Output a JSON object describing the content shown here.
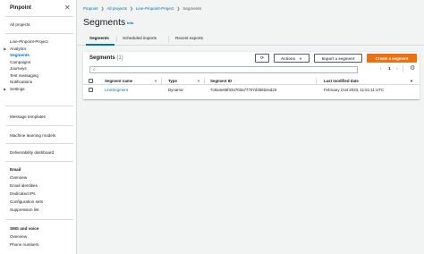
{
  "sidebar": {
    "title": "Pinpoint",
    "all_projects": "All projects",
    "project_name": "Line-Pinpoint-Project",
    "items": [
      {
        "label": "Analytics"
      },
      {
        "label": "Segments"
      },
      {
        "label": "Campaigns"
      },
      {
        "label": "Journeys"
      },
      {
        "label": "Test messaging"
      },
      {
        "label": "Notifications"
      },
      {
        "label": "Settings"
      }
    ],
    "message_templates": "Message templates",
    "ml_models": "Machine learning models",
    "deliverability": "Deliverability dashboard",
    "email_group": "Email",
    "email_items": [
      "Overview",
      "Email identities",
      "Dedicated IPs",
      "Configuration sets",
      "Suppression list"
    ],
    "sms_group": "SMS and voice",
    "sms_items": [
      "Overview",
      "Phone numbers"
    ]
  },
  "breadcrumb": {
    "items": [
      "Pinpoint",
      "All projects",
      "Line-Pinpoint-Project"
    ],
    "current": "Segments"
  },
  "page": {
    "title": "Segments",
    "info": "Info"
  },
  "tabs": [
    "Segments",
    "Scheduled imports",
    "Recent exports"
  ],
  "panel": {
    "title": "Segments",
    "count": "(1)",
    "actions_label": "Actions",
    "import_label": "Import a segment",
    "create_label": "Create a segment",
    "search_placeholder": "",
    "page_number": "1"
  },
  "table": {
    "columns": [
      "Segment name",
      "Type",
      "Segment ID",
      "Last modified date"
    ],
    "rows": [
      {
        "name": "LineSegment",
        "type": "Dynamic",
        "id": "7c8a4e66f334703a77707d3b6b2ed23",
        "modified": "February 21st 2023, 11:51:11 UTC"
      }
    ]
  }
}
